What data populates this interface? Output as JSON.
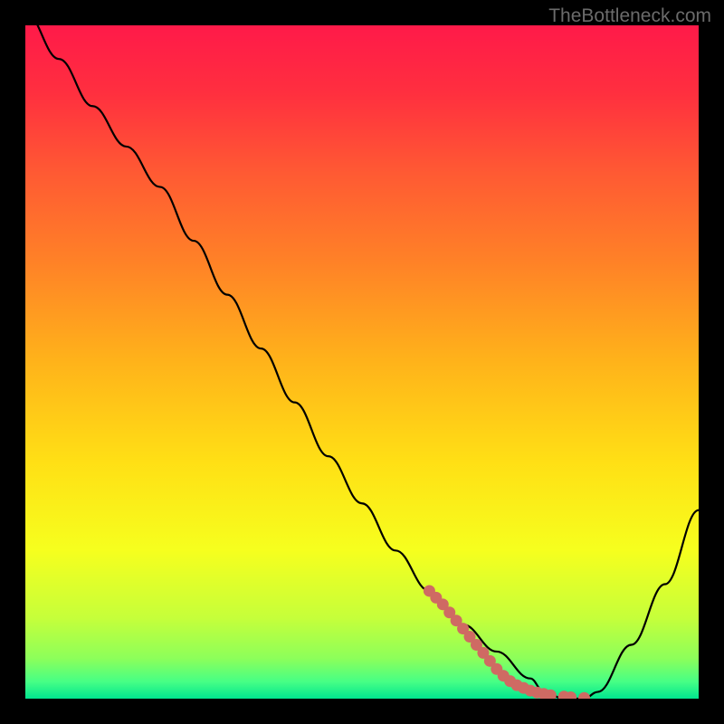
{
  "watermark": "TheBottleneck.com",
  "chart_data": {
    "type": "line",
    "title": "",
    "xlabel": "",
    "ylabel": "",
    "xlim": [
      0,
      100
    ],
    "ylim": [
      0,
      100
    ],
    "series": [
      {
        "name": "curve",
        "color": "#000000",
        "x": [
          0,
          5,
          10,
          15,
          20,
          25,
          30,
          35,
          40,
          45,
          50,
          55,
          60,
          65,
          70,
          75,
          77,
          80,
          83,
          85,
          90,
          95,
          100
        ],
        "y": [
          102,
          95,
          88,
          82,
          76,
          68,
          60,
          52,
          44,
          36,
          29,
          22,
          16,
          11,
          7,
          3,
          1,
          0,
          0,
          1,
          8,
          17,
          28
        ]
      },
      {
        "name": "highlight-dots",
        "color": "#cf6a63",
        "x": [
          60,
          61,
          62,
          63,
          64,
          65,
          66,
          67,
          68,
          69,
          70,
          71,
          72,
          73,
          74,
          75,
          76,
          77,
          78,
          80,
          81,
          83
        ],
        "y": [
          16.0,
          15.0,
          14.0,
          12.8,
          11.6,
          10.4,
          9.2,
          8.0,
          6.8,
          5.6,
          4.4,
          3.4,
          2.6,
          2.0,
          1.6,
          1.2,
          0.9,
          0.7,
          0.5,
          0.3,
          0.2,
          0.1
        ]
      }
    ],
    "gradient_stops": [
      {
        "offset": 0.0,
        "color": "#ff1a49"
      },
      {
        "offset": 0.1,
        "color": "#ff2f3f"
      },
      {
        "offset": 0.22,
        "color": "#ff5a33"
      },
      {
        "offset": 0.35,
        "color": "#ff8127"
      },
      {
        "offset": 0.5,
        "color": "#ffb31a"
      },
      {
        "offset": 0.65,
        "color": "#ffe015"
      },
      {
        "offset": 0.78,
        "color": "#f6ff1e"
      },
      {
        "offset": 0.88,
        "color": "#c6ff3a"
      },
      {
        "offset": 0.94,
        "color": "#8dff5a"
      },
      {
        "offset": 0.975,
        "color": "#46ff85"
      },
      {
        "offset": 1.0,
        "color": "#00e58f"
      }
    ]
  }
}
